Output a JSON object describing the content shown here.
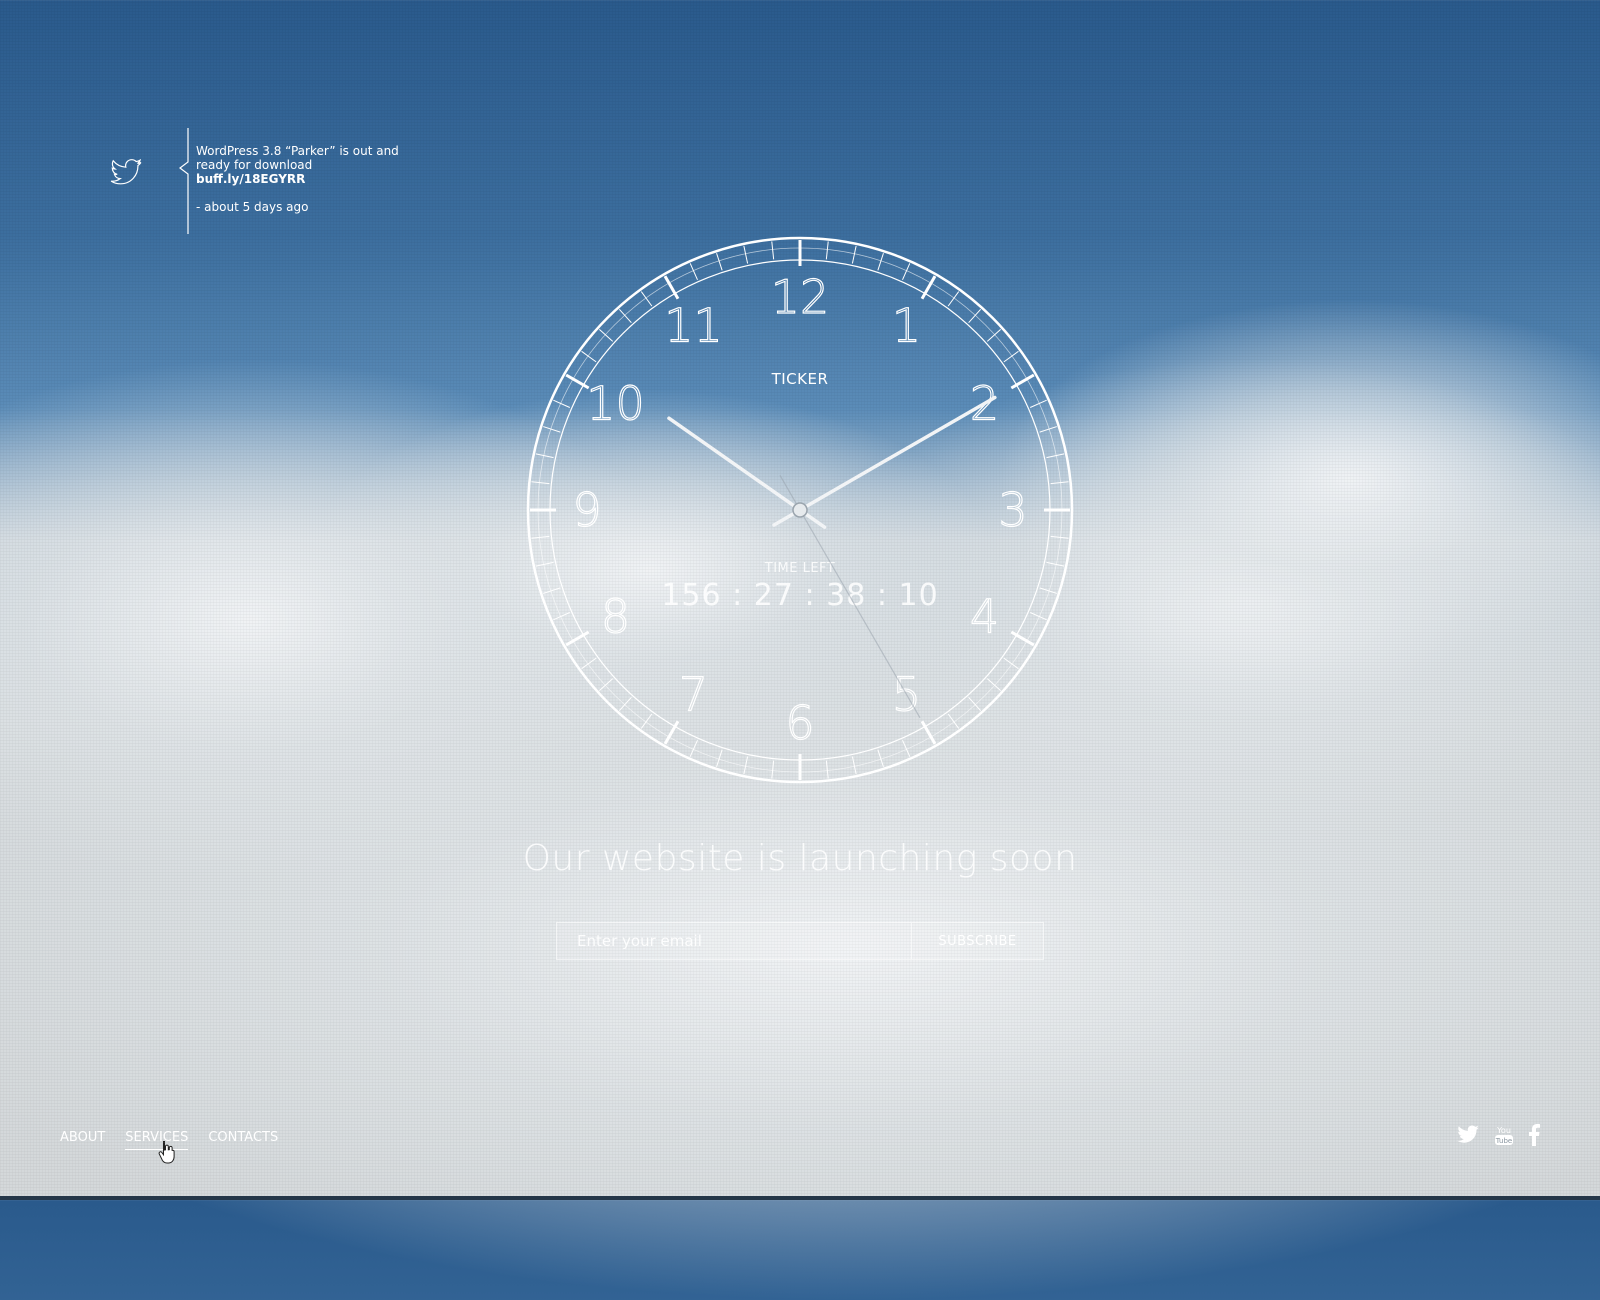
{
  "tweet": {
    "text": "WordPress 3.8 “Parker” is out and ready for download",
    "link": "buff.ly/18EGYRR",
    "time": "- about 5 days ago",
    "icon": "twitter-bird-icon"
  },
  "clock": {
    "brand": "TICKER",
    "numbers": [
      "12",
      "1",
      "2",
      "3",
      "4",
      "5",
      "6",
      "7",
      "8",
      "9",
      "10",
      "11"
    ],
    "time_left_label": "TIME LEFT",
    "time_left_value": "156 : 27 : 38 : 10",
    "hands": {
      "hour": 10,
      "minute": 10,
      "second": 25
    }
  },
  "headline": "Our website is launching soon",
  "subscribe": {
    "placeholder": "Enter your email",
    "button": "SUBSCRIBE"
  },
  "nav": {
    "items": [
      "ABOUT",
      "SERVICES",
      "CONTACTS"
    ],
    "active": "SERVICES"
  },
  "social": {
    "icons": [
      "twitter-icon",
      "youtube-icon",
      "facebook-icon"
    ]
  },
  "colors": {
    "sky_top": "#2a5a8c",
    "sky_mid": "#5b8cb8",
    "cloud": "#d6dbde",
    "text": "#ffffff"
  }
}
